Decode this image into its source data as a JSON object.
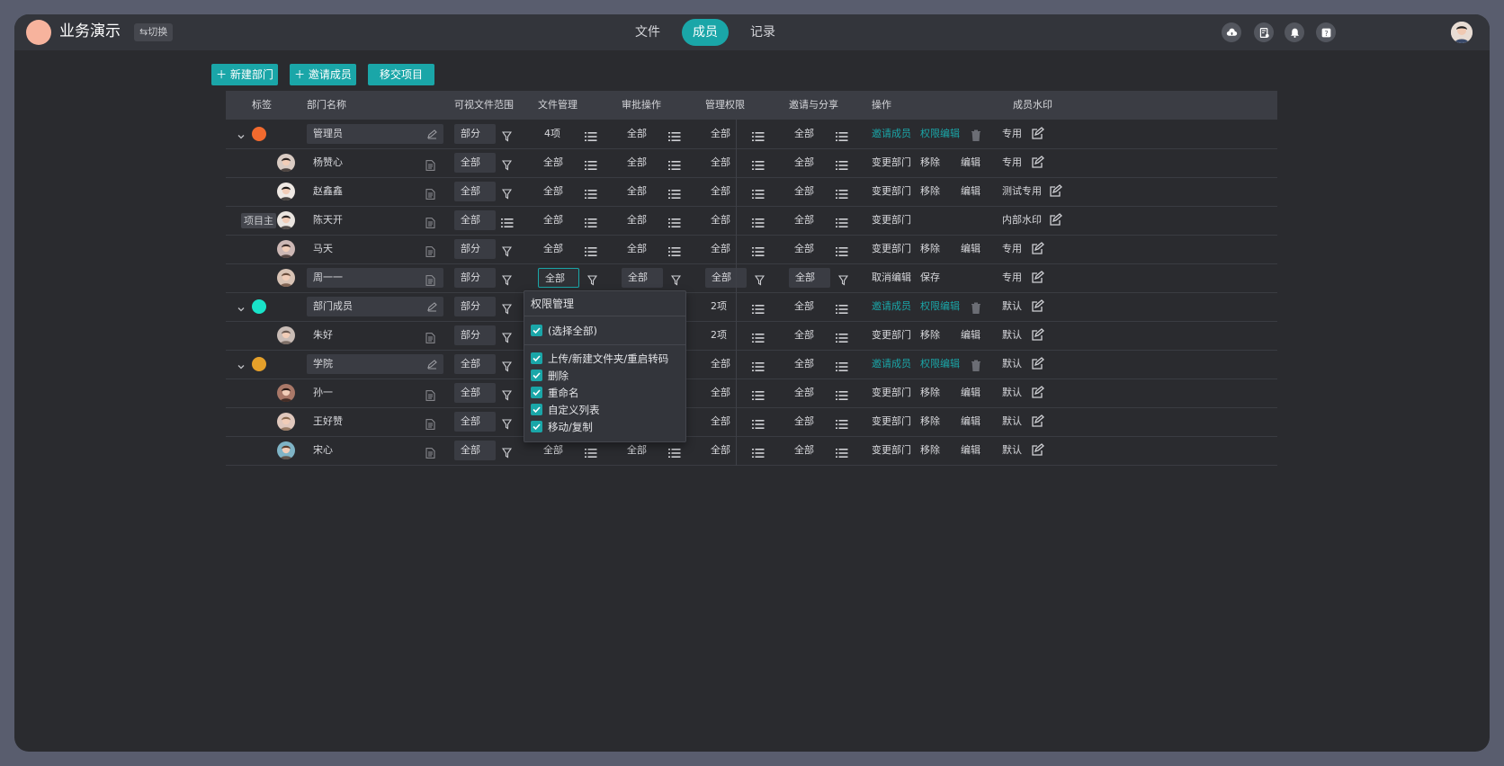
{
  "app": {
    "title": "业务演示",
    "switch_label": "⇆切换",
    "logo_color": "#f7b39d"
  },
  "nav": {
    "tabs": [
      {
        "label": "文件"
      },
      {
        "label": "成员",
        "active": true
      },
      {
        "label": "记录"
      }
    ]
  },
  "header_icons": [
    "cloud-upload-icon",
    "file-settings-icon",
    "bell-icon",
    "help-icon"
  ],
  "toolbar": {
    "new_dept": "新建部门",
    "invite_member": "邀请成员",
    "transfer_project": "移交项目"
  },
  "table": {
    "headers": [
      "标签",
      "部门名称",
      "可视文件范围",
      "文件管理",
      "审批操作",
      "管理权限",
      "邀请与分享",
      "操作",
      "成员水印"
    ],
    "rows": [
      {
        "type": "group",
        "color": "#f26a2e",
        "name": "管理员",
        "scope": "部分",
        "file": "4项",
        "approve": "全部",
        "admin": "全部",
        "invite": "全部",
        "ops": [
          "邀请成员",
          "权限编辑"
        ],
        "watermark": "专用"
      },
      {
        "type": "member",
        "name": "杨赞心",
        "scope": "全部",
        "file": "全部",
        "approve": "全部",
        "admin": "全部",
        "invite": "全部",
        "ops": [
          "变更部门",
          "移除",
          "编辑"
        ],
        "watermark": "专用"
      },
      {
        "type": "member",
        "name": "赵鑫鑫",
        "scope": "全部",
        "file": "全部",
        "approve": "全部",
        "admin": "全部",
        "invite": "全部",
        "ops": [
          "变更部门",
          "移除",
          "编辑"
        ],
        "watermark": "测试专用"
      },
      {
        "type": "member",
        "tag": "项目主",
        "name": "陈天开",
        "scope": "全部",
        "file": "全部",
        "approve": "全部",
        "admin": "全部",
        "invite": "全部",
        "ops": [
          "变更部门"
        ],
        "watermark": "内部水印"
      },
      {
        "type": "member",
        "name": "马天",
        "scope": "部分",
        "file": "全部",
        "approve": "全部",
        "admin": "全部",
        "invite": "全部",
        "ops": [
          "变更部门",
          "移除",
          "编辑"
        ],
        "watermark": "专用"
      },
      {
        "type": "editing",
        "name": "周一一",
        "scope": "部分",
        "file": "全部",
        "approve": "全部",
        "admin": "全部",
        "invite": "全部",
        "ops": [
          "取消编辑",
          "保存"
        ],
        "watermark": "专用"
      },
      {
        "type": "group",
        "color": "#19e3c9",
        "name": "部门成员",
        "scope": "部分",
        "file": "",
        "approve": "",
        "admin": "2项",
        "invite": "全部",
        "ops": [
          "邀请成员",
          "权限编辑"
        ],
        "watermark": "默认"
      },
      {
        "type": "member",
        "name": "朱好",
        "scope": "部分",
        "file": "",
        "approve": "",
        "admin": "2项",
        "invite": "全部",
        "ops": [
          "变更部门",
          "移除",
          "编辑"
        ],
        "watermark": "默认"
      },
      {
        "type": "group",
        "color": "#e5a02a",
        "name": "学院",
        "scope": "全部",
        "file": "",
        "approve": "",
        "admin": "全部",
        "invite": "全部",
        "ops": [
          "邀请成员",
          "权限编辑"
        ],
        "watermark": "默认"
      },
      {
        "type": "member",
        "name": "孙一",
        "scope": "全部",
        "file": "",
        "approve": "",
        "admin": "全部",
        "invite": "全部",
        "ops": [
          "变更部门",
          "移除",
          "编辑"
        ],
        "watermark": "默认"
      },
      {
        "type": "member",
        "name": "王好赞",
        "scope": "全部",
        "file": "",
        "approve": "",
        "admin": "全部",
        "invite": "全部",
        "ops": [
          "变更部门",
          "移除",
          "编辑"
        ],
        "watermark": "默认"
      },
      {
        "type": "member",
        "name": "宋心",
        "scope": "全部",
        "file": "全部",
        "approve": "全部",
        "admin": "全部",
        "invite": "全部",
        "ops": [
          "变更部门",
          "移除",
          "编辑"
        ],
        "watermark": "默认"
      }
    ]
  },
  "popup": {
    "title": "权限管理",
    "select_all": "(选择全部)",
    "items": [
      "上传/新建文件夹/重启转码",
      "删除",
      "重命名",
      "自定义列表",
      "移动/复制"
    ]
  },
  "colors": {
    "accent": "#1aa6a8",
    "background": "#2a2b2f",
    "header": "#33353b"
  }
}
